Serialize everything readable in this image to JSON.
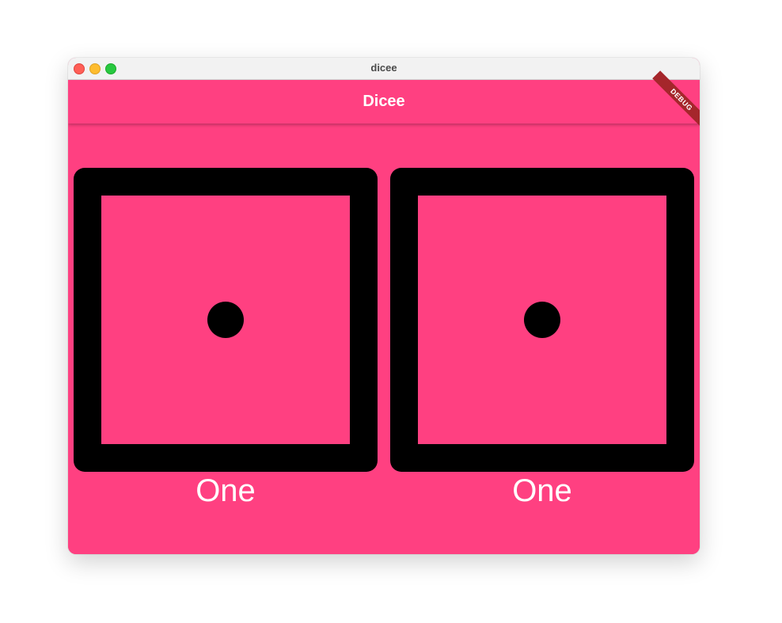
{
  "window": {
    "title": "dicee"
  },
  "appbar": {
    "title": "Dicee",
    "debug_banner": "DEBUG"
  },
  "dice": [
    {
      "face_value": 1,
      "label": "One"
    },
    {
      "face_value": 1,
      "label": "One"
    }
  ],
  "colors": {
    "background": "#ff4081",
    "die_border": "#000000",
    "pip": "#000000",
    "text": "#ffffff",
    "debug_banner": "#a5262b"
  }
}
